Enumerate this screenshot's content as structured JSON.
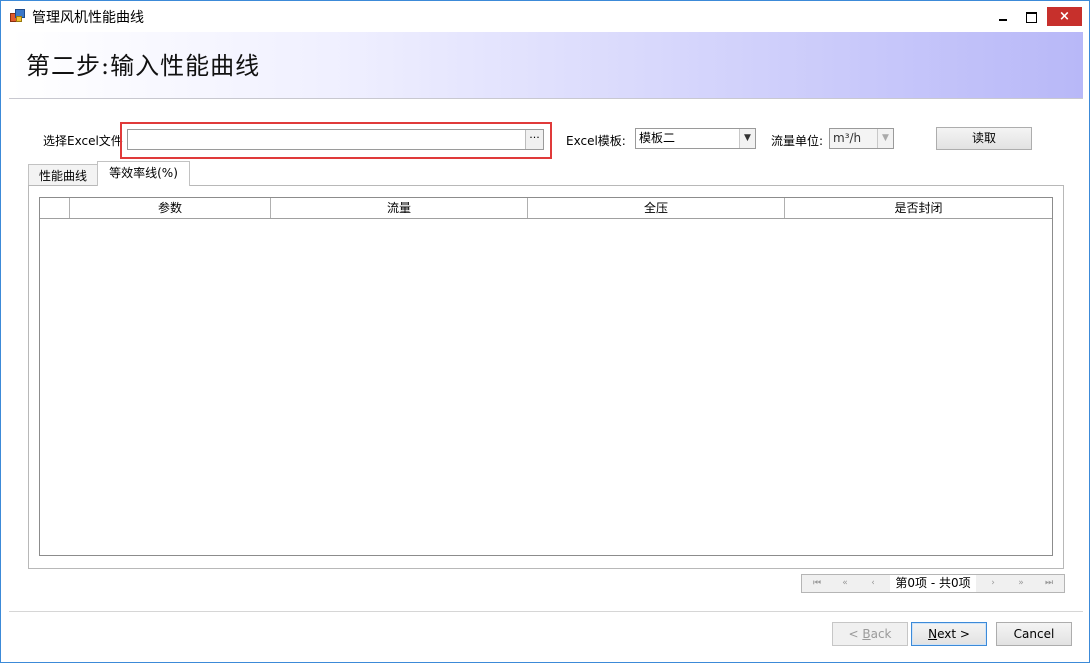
{
  "window": {
    "title": "管理风机性能曲线",
    "close_glyph": "×"
  },
  "header": {
    "title": "第二步:输入性能曲线"
  },
  "form": {
    "file_label": "选择Excel文件",
    "file_value": "",
    "browse_glyph": "···",
    "template_label": "Excel模板:",
    "template_value": "模板二",
    "unit_label": "流量单位:",
    "unit_value": "m³/h",
    "read_button": "读取"
  },
  "tabs": [
    {
      "label": "性能曲线",
      "active": false
    },
    {
      "label": "等效率线(%)",
      "active": true
    }
  ],
  "grid": {
    "columns": [
      "",
      "参数",
      "流量",
      "全压",
      "是否封闭"
    ],
    "rows": []
  },
  "pager": {
    "first": "⏮",
    "prev_page": "«",
    "prev": "‹",
    "text": "第0项 - 共0项",
    "next": "›",
    "next_page": "»",
    "last": "⏭"
  },
  "wizard": {
    "back_prefix": "< ",
    "back_key": "B",
    "back_rest": "ack",
    "next_key": "N",
    "next_rest": "ext >",
    "cancel": "Cancel"
  },
  "colors": {
    "accent": "#3c8ad8",
    "highlight": "#e03a3a",
    "close": "#c7302c"
  }
}
